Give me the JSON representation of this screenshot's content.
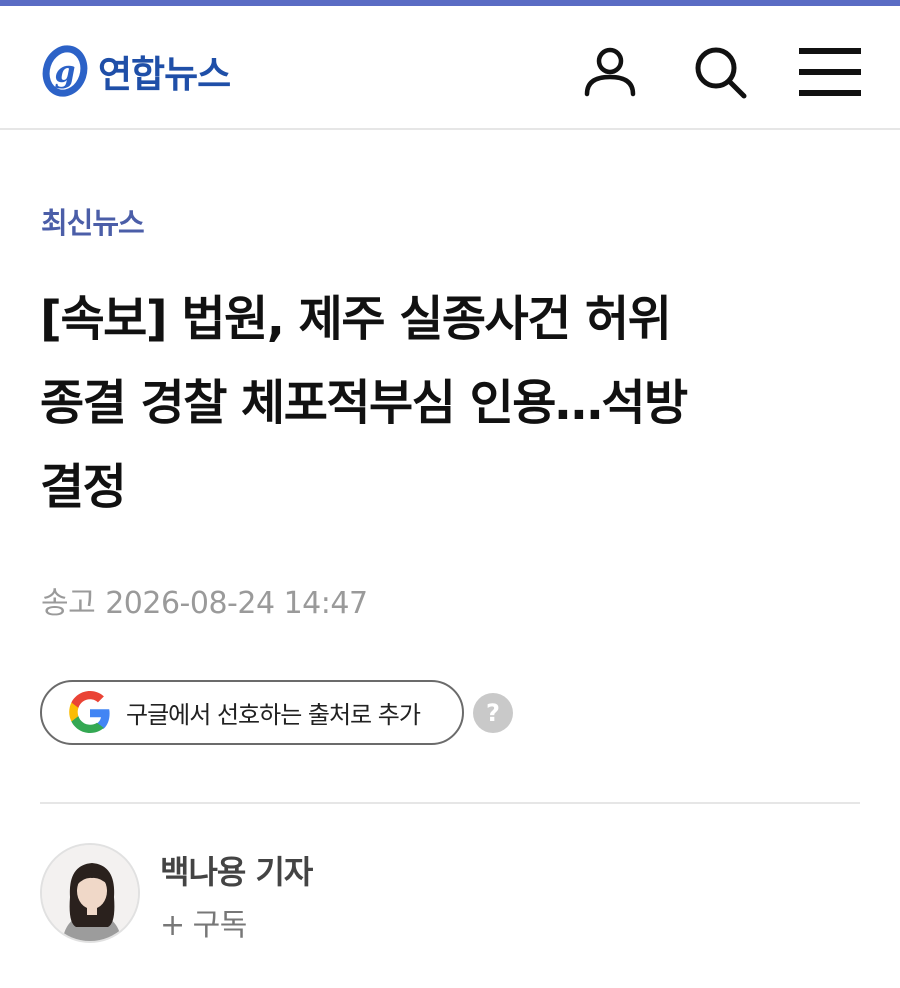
{
  "header": {
    "logo_text": "연합뉴스",
    "icons": [
      "user-icon",
      "search-icon",
      "menu-icon"
    ]
  },
  "article": {
    "category": "최신뉴스",
    "headline_lines": [
      "[속보] 법원, 제주 실종사건 허위",
      "종결 경찰 체포적부심 인용…석방",
      "결정"
    ],
    "date_label": "송고",
    "date_value": "2026-08-24 14:47"
  },
  "google_pref": {
    "label": "구글에서 선호하는 출처로 추가",
    "help": "?"
  },
  "reporter": {
    "name": "백나용 기자",
    "subscribe_plus": "+",
    "subscribe_label": "구독"
  },
  "colors": {
    "brand": "#1f4fa8",
    "category": "#4b5ea8",
    "top_strip": "#5a6cc4"
  }
}
